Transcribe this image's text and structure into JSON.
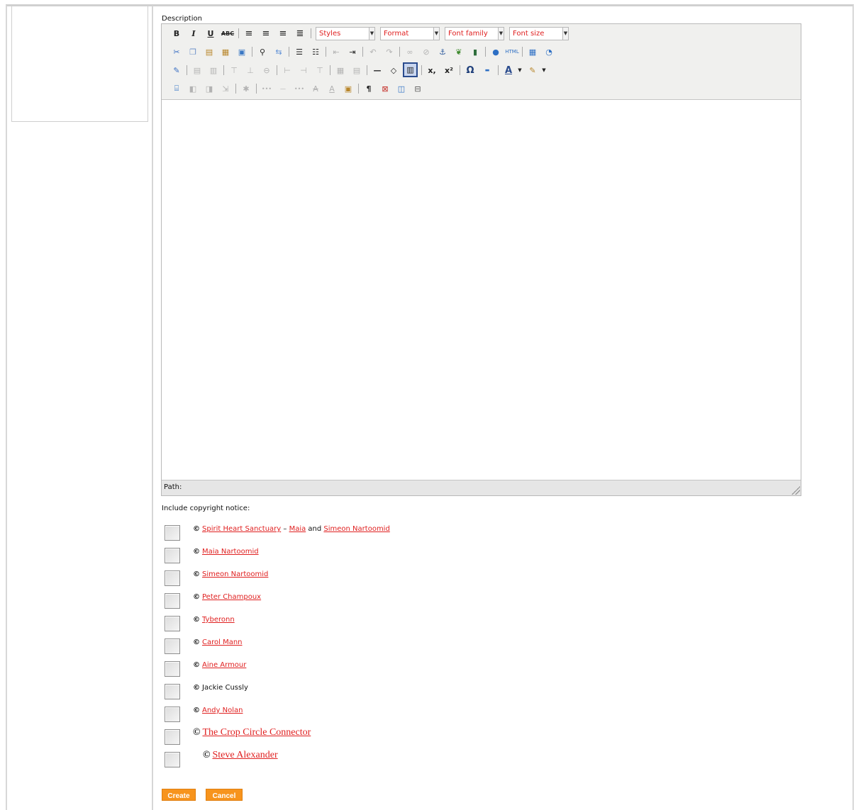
{
  "form": {
    "description_label": "Description",
    "copyright_label": "Include copyright notice:"
  },
  "editor": {
    "selects": {
      "styles": "Styles",
      "format": "Format",
      "font_family": "Font family",
      "font_size": "Font size"
    },
    "status_path_label": "Path:"
  },
  "notices": [
    {
      "mark": "©",
      "parts": [
        {
          "text": "Spirit Heart Sanctuary",
          "link": true
        },
        {
          "text": " – ",
          "link": false
        },
        {
          "text": "Maia",
          "link": true
        },
        {
          "text": " and ",
          "link": false
        },
        {
          "text": "Simeon Nartoomid",
          "link": true
        }
      ]
    },
    {
      "mark": "©",
      "parts": [
        {
          "text": "Maia Nartoomid",
          "link": true
        }
      ]
    },
    {
      "mark": "©",
      "parts": [
        {
          "text": "Simeon Nartoomid",
          "link": true
        }
      ]
    },
    {
      "mark": "©",
      "parts": [
        {
          "text": "Peter Champoux",
          "link": true
        }
      ]
    },
    {
      "mark": "©",
      "parts": [
        {
          "text": "Tyberonn",
          "link": true
        }
      ]
    },
    {
      "mark": "©",
      "parts": [
        {
          "text": "Carol Mann",
          "link": true
        }
      ]
    },
    {
      "mark": "©",
      "parts": [
        {
          "text": "Aine Armour",
          "link": true
        }
      ]
    },
    {
      "mark": "©",
      "parts": [
        {
          "text": "Jackie Cussly",
          "link": false
        }
      ]
    },
    {
      "mark": "©",
      "parts": [
        {
          "text": "Andy Nolan",
          "link": true
        }
      ]
    },
    {
      "mark": "©",
      "parts": [
        {
          "text": "The Crop Circle Connector",
          "link": true
        }
      ],
      "large": true
    },
    {
      "mark": "©",
      "parts": [
        {
          "text": "Steve Alexander",
          "link": true
        }
      ],
      "large": true,
      "indent": true
    }
  ],
  "buttons": {
    "create": "Create",
    "cancel": "Cancel"
  },
  "colors": {
    "link": "#e02020",
    "button": "#f7941d"
  }
}
